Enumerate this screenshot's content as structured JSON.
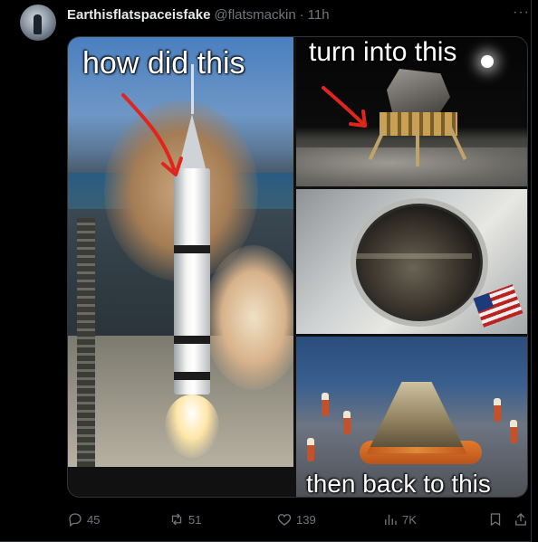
{
  "post": {
    "display_name": "Earthisflatspaceisfake",
    "handle": "@flatsmackin",
    "separator": "·",
    "time": "11h",
    "more_icon": "more-horizontal-icon",
    "more_text": "···"
  },
  "image": {
    "caption_top_left": "how did this",
    "caption_top_right": "turn into this",
    "caption_bottom_right": "then back to this",
    "arrow_color": "#e0261c"
  },
  "actions": {
    "replies": "45",
    "reposts": "51",
    "likes": "139",
    "views": "7K"
  },
  "colors": {
    "background": "#000000",
    "text_primary": "#e7e9ea",
    "text_secondary": "#71767b",
    "border": "#2f3336"
  }
}
